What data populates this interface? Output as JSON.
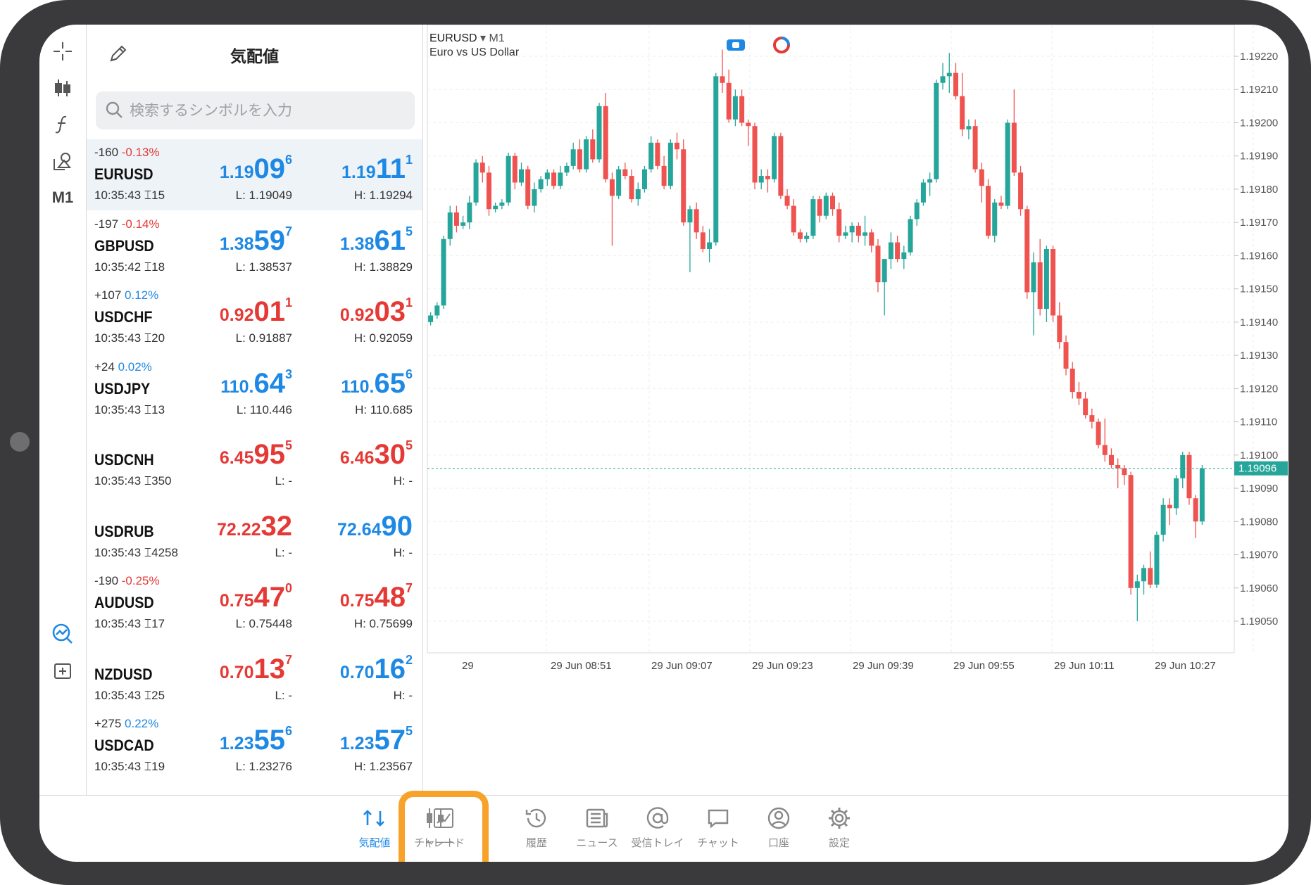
{
  "rail": {
    "tools": [
      "crosshair-icon",
      "candles-icon",
      "function-icon",
      "objects-icon",
      "chart-status-icon",
      "add-window-icon"
    ],
    "timeframe": "M1"
  },
  "quotes": {
    "title": "気配値",
    "search_placeholder": "検索するシンボルを入力",
    "rows": [
      {
        "change_points": "-160",
        "change_pct": "-0.13%",
        "symbol": "EURUSD",
        "time": "10:35:43",
        "spread": "15",
        "bid": {
          "small": "1.19",
          "big": "09",
          "sup": "6"
        },
        "ask": {
          "small": "1.19",
          "big": "11",
          "sup": "1"
        },
        "low": "L: 1.19049",
        "high": "H: 1.19294"
      },
      {
        "change_points": "-197",
        "change_pct": "-0.14%",
        "symbol": "GBPUSD",
        "time": "10:35:42",
        "spread": "18",
        "bid": {
          "small": "1.38",
          "big": "59",
          "sup": "7"
        },
        "ask": {
          "small": "1.38",
          "big": "61",
          "sup": "5"
        },
        "low": "L: 1.38537",
        "high": "H: 1.38829"
      },
      {
        "change_points": "+107",
        "change_pct": "0.12%",
        "symbol": "USDCHF",
        "time": "10:35:43",
        "spread": "20",
        "bid": {
          "small": "0.92",
          "big": "01",
          "sup": "1"
        },
        "ask": {
          "small": "0.92",
          "big": "03",
          "sup": "1"
        },
        "low": "L: 0.91887",
        "high": "H: 0.92059"
      },
      {
        "change_points": "+24",
        "change_pct": "0.02%",
        "symbol": "USDJPY",
        "time": "10:35:43",
        "spread": "13",
        "bid": {
          "small": "110.",
          "big": "64",
          "sup": "3"
        },
        "ask": {
          "small": "110.",
          "big": "65",
          "sup": "6"
        },
        "low": "L: 110.446",
        "high": "H: 110.685"
      },
      {
        "change_points": "",
        "change_pct": "",
        "symbol": "USDCNH",
        "time": "10:35:43",
        "spread": "350",
        "bid": {
          "small": "6.45",
          "big": "95",
          "sup": "5"
        },
        "ask": {
          "small": "6.46",
          "big": "30",
          "sup": "5"
        },
        "low": "L: -",
        "high": "H: -"
      },
      {
        "change_points": "",
        "change_pct": "",
        "symbol": "USDRUB",
        "time": "10:35:43",
        "spread": "4258",
        "bid": {
          "small": "72.22",
          "big": "32",
          "sup": ""
        },
        "ask": {
          "small": "72.64",
          "big": "90",
          "sup": ""
        },
        "low": "L: -",
        "high": "H: -"
      },
      {
        "change_points": "-190",
        "change_pct": "-0.25%",
        "symbol": "AUDUSD",
        "time": "10:35:43",
        "spread": "17",
        "bid": {
          "small": "0.75",
          "big": "47",
          "sup": "0"
        },
        "ask": {
          "small": "0.75",
          "big": "48",
          "sup": "7"
        },
        "low": "L: 0.75448",
        "high": "H: 0.75699"
      },
      {
        "change_points": "",
        "change_pct": "",
        "symbol": "NZDUSD",
        "time": "10:35:43",
        "spread": "25",
        "bid": {
          "small": "0.70",
          "big": "13",
          "sup": "7"
        },
        "ask": {
          "small": "0.70",
          "big": "16",
          "sup": "2"
        },
        "low": "L: -",
        "high": "H: -"
      },
      {
        "change_points": "+275",
        "change_pct": "0.22%",
        "symbol": "USDCAD",
        "time": "10:35:43",
        "spread": "19",
        "bid": {
          "small": "1.23",
          "big": "55",
          "sup": "6"
        },
        "ask": {
          "small": "1.23",
          "big": "57",
          "sup": "5"
        },
        "low": "L: 1.23276",
        "high": "H: 1.23567"
      }
    ]
  },
  "chart": {
    "symbol": "EURUSD",
    "timeframe": "M1",
    "description": "Euro vs US Dollar",
    "current_price": "1.19096",
    "y_ticks": [
      "1.19220",
      "1.19210",
      "1.19200",
      "1.19190",
      "1.19180",
      "1.19170",
      "1.19160",
      "1.19150",
      "1.19140",
      "1.19130",
      "1.19120",
      "1.19110",
      "1.19100",
      "1.19090",
      "1.19080",
      "1.19070",
      "1.19060",
      "1.19050"
    ],
    "x_ticks": [
      "29",
      "29 Jun 08:51",
      "29 Jun 09:07",
      "29 Jun 09:23",
      "29 Jun 09:39",
      "29 Jun 09:55",
      "29 Jun 10:11",
      "29 Jun 10:27"
    ],
    "colors": {
      "up": "#26a69a",
      "down": "#ef5350",
      "grid": "#eeeeee",
      "price_line": "#26a69a"
    }
  },
  "chart_data": {
    "type": "candlestick",
    "ylim": [
      1.19045,
      1.19225
    ],
    "ohlc": [
      [
        1.1914,
        1.19143,
        1.19139,
        1.19142
      ],
      [
        1.19142,
        1.19146,
        1.19141,
        1.19145
      ],
      [
        1.19145,
        1.19166,
        1.19144,
        1.19165
      ],
      [
        1.19165,
        1.19175,
        1.19163,
        1.19173
      ],
      [
        1.19173,
        1.19175,
        1.19167,
        1.19169
      ],
      [
        1.19169,
        1.19172,
        1.19168,
        1.1917
      ],
      [
        1.1917,
        1.19178,
        1.19168,
        1.19176
      ],
      [
        1.19176,
        1.19189,
        1.19175,
        1.19188
      ],
      [
        1.19188,
        1.1919,
        1.19182,
        1.19185
      ],
      [
        1.19185,
        1.19187,
        1.19172,
        1.19174
      ],
      [
        1.19174,
        1.19176,
        1.19173,
        1.19175
      ],
      [
        1.19175,
        1.19177,
        1.19174,
        1.19176
      ],
      [
        1.19176,
        1.19191,
        1.19175,
        1.1919
      ],
      [
        1.1919,
        1.19191,
        1.1918,
        1.19182
      ],
      [
        1.19182,
        1.19188,
        1.19181,
        1.19186
      ],
      [
        1.19186,
        1.19187,
        1.19174,
        1.19175
      ],
      [
        1.19175,
        1.19182,
        1.19173,
        1.1918
      ],
      [
        1.1918,
        1.19184,
        1.19179,
        1.19183
      ],
      [
        1.19183,
        1.19186,
        1.19181,
        1.19185
      ],
      [
        1.19185,
        1.19186,
        1.1918,
        1.19181
      ],
      [
        1.19181,
        1.19187,
        1.1918,
        1.19185
      ],
      [
        1.19185,
        1.19188,
        1.19184,
        1.19187
      ],
      [
        1.19187,
        1.19194,
        1.19186,
        1.19192
      ],
      [
        1.19192,
        1.19195,
        1.19185,
        1.19186
      ],
      [
        1.19186,
        1.19196,
        1.19185,
        1.19195
      ],
      [
        1.19195,
        1.19198,
        1.19188,
        1.19189
      ],
      [
        1.19189,
        1.19206,
        1.19188,
        1.19205
      ],
      [
        1.19205,
        1.19209,
        1.19182,
        1.19183
      ],
      [
        1.19183,
        1.19185,
        1.19163,
        1.19178
      ],
      [
        1.19178,
        1.19187,
        1.19177,
        1.19186
      ],
      [
        1.19186,
        1.19188,
        1.19183,
        1.19184
      ],
      [
        1.19184,
        1.19186,
        1.19176,
        1.19177
      ],
      [
        1.19177,
        1.19182,
        1.19175,
        1.1918
      ],
      [
        1.1918,
        1.19187,
        1.19179,
        1.19186
      ],
      [
        1.19186,
        1.19196,
        1.19185,
        1.19194
      ],
      [
        1.19194,
        1.19195,
        1.19186,
        1.19187
      ],
      [
        1.19187,
        1.1919,
        1.1918,
        1.19181
      ],
      [
        1.19181,
        1.19195,
        1.1918,
        1.19194
      ],
      [
        1.19194,
        1.19197,
        1.19189,
        1.19192
      ],
      [
        1.19192,
        1.19195,
        1.19169,
        1.1917
      ],
      [
        1.1917,
        1.19175,
        1.19155,
        1.19174
      ],
      [
        1.19174,
        1.19176,
        1.19165,
        1.19167
      ],
      [
        1.19167,
        1.19169,
        1.19161,
        1.19162
      ],
      [
        1.19162,
        1.19168,
        1.19158,
        1.19164
      ],
      [
        1.19164,
        1.19215,
        1.19163,
        1.19214
      ],
      [
        1.19214,
        1.19222,
        1.19209,
        1.19212
      ],
      [
        1.19212,
        1.19216,
        1.192,
        1.19201
      ],
      [
        1.19201,
        1.1921,
        1.19199,
        1.19208
      ],
      [
        1.19208,
        1.1921,
        1.19199,
        1.192
      ],
      [
        1.192,
        1.19201,
        1.19193,
        1.19199
      ],
      [
        1.19199,
        1.192,
        1.1918,
        1.19182
      ],
      [
        1.19182,
        1.19186,
        1.1918,
        1.19184
      ],
      [
        1.19184,
        1.19186,
        1.19179,
        1.19183
      ],
      [
        1.19183,
        1.19197,
        1.19182,
        1.19196
      ],
      [
        1.19196,
        1.19197,
        1.19177,
        1.19178
      ],
      [
        1.19178,
        1.1918,
        1.19174,
        1.19175
      ],
      [
        1.19175,
        1.19177,
        1.19166,
        1.19167
      ],
      [
        1.19167,
        1.19168,
        1.19164,
        1.19165
      ],
      [
        1.19165,
        1.19167,
        1.19164,
        1.19166
      ],
      [
        1.19166,
        1.19178,
        1.19165,
        1.19177
      ],
      [
        1.19177,
        1.19178,
        1.1917,
        1.19172
      ],
      [
        1.19172,
        1.19179,
        1.19171,
        1.19178
      ],
      [
        1.19178,
        1.19179,
        1.19172,
        1.19174
      ],
      [
        1.19174,
        1.19176,
        1.19164,
        1.19166
      ],
      [
        1.19166,
        1.19169,
        1.19165,
        1.19167
      ],
      [
        1.19167,
        1.1917,
        1.19164,
        1.19169
      ],
      [
        1.19169,
        1.1917,
        1.19164,
        1.19166
      ],
      [
        1.19166,
        1.19172,
        1.19163,
        1.19167
      ],
      [
        1.19167,
        1.19168,
        1.19161,
        1.19163
      ],
      [
        1.19163,
        1.19165,
        1.19149,
        1.19152
      ],
      [
        1.19152,
        1.19157,
        1.19142,
        1.19159
      ],
      [
        1.19159,
        1.19167,
        1.19156,
        1.19164
      ],
      [
        1.19164,
        1.19166,
        1.19158,
        1.19159
      ],
      [
        1.19159,
        1.19163,
        1.19156,
        1.19161
      ],
      [
        1.19161,
        1.19172,
        1.1916,
        1.19171
      ],
      [
        1.19171,
        1.19177,
        1.19169,
        1.19176
      ],
      [
        1.19176,
        1.19183,
        1.19175,
        1.19182
      ],
      [
        1.19182,
        1.19185,
        1.19178,
        1.19183
      ],
      [
        1.19183,
        1.19213,
        1.19182,
        1.19212
      ],
      [
        1.19212,
        1.19218,
        1.1921,
        1.19214
      ],
      [
        1.19214,
        1.19221,
        1.19209,
        1.19215
      ],
      [
        1.19215,
        1.19218,
        1.19207,
        1.19208
      ],
      [
        1.19208,
        1.19215,
        1.19196,
        1.19198
      ],
      [
        1.19198,
        1.19201,
        1.19195,
        1.19199
      ],
      [
        1.19199,
        1.19201,
        1.19185,
        1.19186
      ],
      [
        1.19186,
        1.19188,
        1.19176,
        1.19181
      ],
      [
        1.19181,
        1.19183,
        1.19165,
        1.19166
      ],
      [
        1.19166,
        1.19177,
        1.19164,
        1.19176
      ],
      [
        1.19176,
        1.19178,
        1.19174,
        1.19175
      ],
      [
        1.19175,
        1.19201,
        1.19174,
        1.192
      ],
      [
        1.192,
        1.1921,
        1.19184,
        1.19185
      ],
      [
        1.19185,
        1.19187,
        1.19172,
        1.19174
      ],
      [
        1.19174,
        1.19175,
        1.19147,
        1.19149
      ],
      [
        1.19149,
        1.19161,
        1.19136,
        1.19158
      ],
      [
        1.19158,
        1.19165,
        1.19142,
        1.19144
      ],
      [
        1.19144,
        1.19163,
        1.1914,
        1.19162
      ],
      [
        1.19162,
        1.19163,
        1.1914,
        1.19142
      ],
      [
        1.19142,
        1.19146,
        1.19132,
        1.19134
      ],
      [
        1.19134,
        1.19136,
        1.19124,
        1.19126
      ],
      [
        1.19126,
        1.19128,
        1.19117,
        1.19119
      ],
      [
        1.19119,
        1.19122,
        1.19115,
        1.19117
      ],
      [
        1.19117,
        1.19119,
        1.19111,
        1.19112
      ],
      [
        1.19112,
        1.19114,
        1.19108,
        1.1911
      ],
      [
        1.1911,
        1.19111,
        1.19102,
        1.19103
      ],
      [
        1.19103,
        1.19111,
        1.19098,
        1.191
      ],
      [
        1.191,
        1.19102,
        1.19096,
        1.19097
      ],
      [
        1.19097,
        1.19099,
        1.1909,
        1.19096
      ],
      [
        1.19096,
        1.19097,
        1.19091,
        1.19094
      ],
      [
        1.19094,
        1.19095,
        1.19058,
        1.1906
      ],
      [
        1.1906,
        1.19064,
        1.1905,
        1.19062
      ],
      [
        1.19062,
        1.19067,
        1.19058,
        1.19066
      ],
      [
        1.19066,
        1.19071,
        1.1906,
        1.19061
      ],
      [
        1.19061,
        1.19077,
        1.1906,
        1.19076
      ],
      [
        1.19076,
        1.19087,
        1.19074,
        1.19085
      ],
      [
        1.19085,
        1.19087,
        1.19079,
        1.19084
      ],
      [
        1.19084,
        1.19094,
        1.19082,
        1.19093
      ],
      [
        1.19093,
        1.19101,
        1.1909,
        1.191
      ],
      [
        1.191,
        1.19101,
        1.19085,
        1.19087
      ],
      [
        1.19087,
        1.19088,
        1.19075,
        1.1908
      ],
      [
        1.1908,
        1.19097,
        1.19079,
        1.19096
      ]
    ]
  },
  "tabbar": {
    "tabs": [
      {
        "label": "気配値",
        "icon": "quotes-icon"
      },
      {
        "label": "チャート",
        "icon": "chart-icon"
      },
      {
        "label": "トレード",
        "icon": "trade-icon"
      },
      {
        "label": "履歴",
        "icon": "history-icon"
      },
      {
        "label": "ニュース",
        "icon": "news-icon"
      },
      {
        "label": "受信トレイ",
        "icon": "mailbox-icon"
      },
      {
        "label": "チャット",
        "icon": "chat-icon"
      },
      {
        "label": "口座",
        "icon": "account-icon"
      },
      {
        "label": "設定",
        "icon": "settings-icon"
      }
    ]
  }
}
